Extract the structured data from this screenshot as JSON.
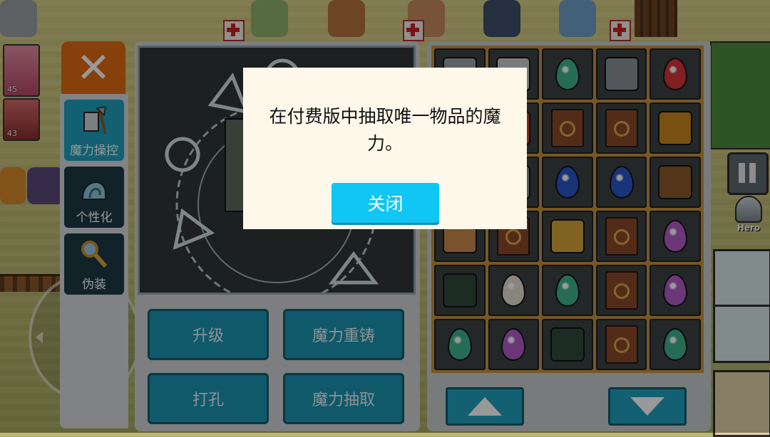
{
  "side_tabs": [
    {
      "label": "魔力操控",
      "icon": "axe-scroll-icon",
      "active": true
    },
    {
      "label": "个性化",
      "icon": "snail-shell-icon",
      "active": false
    },
    {
      "label": "伪装",
      "icon": "magnifier-key-icon",
      "active": false
    }
  ],
  "close_icon": "close-x-icon",
  "actions": {
    "upgrade": "升级",
    "reforge": "魔力重铸",
    "socket": "打孔",
    "extract": "魔力抽取"
  },
  "hud": {
    "hero_label": "Hero",
    "party_levels": [
      "45",
      "43"
    ]
  },
  "inventory": [
    "axe-icon",
    "sickle-icon",
    "green-gem-icon",
    "sword-icon",
    "red-gem-icon",
    "spear-icon",
    "torch-icon",
    "spellbook-icon",
    "spellbook-icon",
    "gold-armor-icon",
    "axe-icon",
    "helmet-icon",
    "blue-gem-icon",
    "blue-gem-icon",
    "bow-icon",
    "shield-icon",
    "spellbook-icon",
    "amulet-icon",
    "spellbook-icon",
    "purple-gem-icon",
    "dark-armor-icon",
    "white-gem-icon",
    "green-gem-icon",
    "spellbook-icon",
    "purple-gem-icon",
    "green-gem-icon",
    "purple-gem-icon",
    "dark-armor-icon",
    "spellbook-icon",
    "green-gem-icon"
  ],
  "dialog": {
    "message": "在付费版中抽取唯一物品的魔力。",
    "close_label": "关闭"
  },
  "colors": {
    "accent": "#1fa0bd",
    "close_orange": "#e36b11",
    "dialog_button": "#0fc6f4"
  }
}
